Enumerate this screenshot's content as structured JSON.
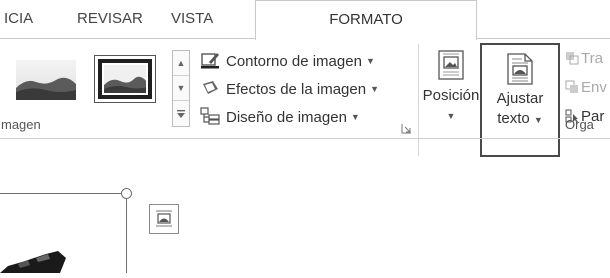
{
  "tabs": {
    "inicio_partial": "ICIA",
    "revisar": "REVISAR",
    "vista": "VISTA",
    "formato": "FORMATO"
  },
  "ribbon": {
    "estilos_group_label_partial": "magen",
    "commands": {
      "contorno": "Contorno de imagen",
      "efectos": "Efectos de la imagen",
      "diseno": "Diseño de imagen"
    },
    "posicion_label": "Posición",
    "ajustar_line1": "Ajustar",
    "ajustar_line2": "texto",
    "organizar_group_label_partial": "Orga",
    "small_cmds": {
      "traer_partial": "Tra",
      "enviar_partial": "Env",
      "panel_partial": "Par"
    }
  },
  "icons": {
    "dropdown": "caret-down",
    "gallery_scroll_up": "triangle-up",
    "gallery_scroll_down": "triangle-down",
    "gallery_more": "triangle-down-bar",
    "dialog_launcher": "corner-arrow"
  },
  "colors": {
    "ui_text": "#444444",
    "ribbon_border": "#c9c9c9",
    "ajustar_box_border": "#4a4a4a"
  }
}
